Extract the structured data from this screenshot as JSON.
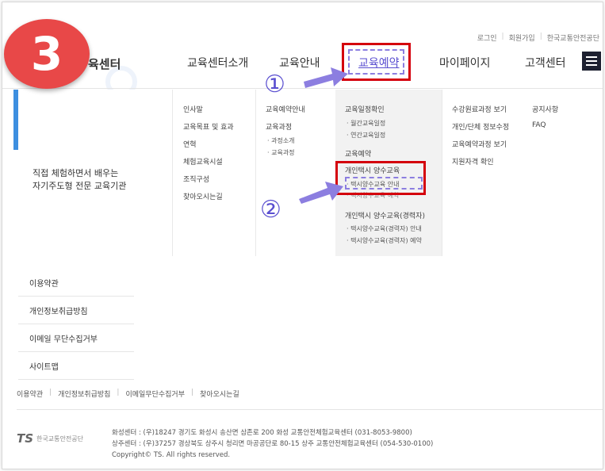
{
  "util_links": [
    "로그인",
    "회원가입",
    "한국교통안전공단"
  ],
  "step_badge": "3",
  "logo_text": "육센터",
  "gnb": {
    "items": [
      "교육센터소개",
      "교육안내",
      "교육예약",
      "마이페이지",
      "고객센터"
    ],
    "active": "교육예약"
  },
  "annotations": {
    "marker1": "①",
    "marker2": "②"
  },
  "slogan": [
    "직접 체험하면서 배우는",
    "자기주도형 전문 교육기관"
  ],
  "mega": {
    "col_intro": [
      "인사말",
      "교육목표 및 효과",
      "연혁",
      "체험교육시설",
      "조직구성",
      "찾아오시는길"
    ],
    "col_guide": {
      "title": "교육예약안내",
      "course_title": "교육과정",
      "subs": [
        "과정소개",
        "교육과정"
      ]
    },
    "col_reserve": {
      "schedule_title": "교육일정확인",
      "schedule_subs": [
        "월간교육일정",
        "연간교육일정"
      ],
      "reserve": "교육예약",
      "taxi_title": "개인택시 양수교육",
      "taxi_subs": [
        "택시양수교육 안내",
        "택시양수교육 예약"
      ],
      "taxi_career_title": "개인택시 양수교육(경력자)",
      "taxi_career_subs": [
        "택시양수교육(경력자) 안내",
        "택시양수교육(경력자) 예약"
      ]
    },
    "col_mypage": [
      "수강원료과정 보기",
      "개인/단체 정보수정",
      "교육예약과정 보기",
      "지원자격 확인"
    ],
    "col_cs": [
      "공지사항",
      "FAQ"
    ]
  },
  "side_list": [
    "이용약관",
    "개인정보취급방침",
    "이메일 무단수집거부",
    "사이트맵"
  ],
  "footer_links": [
    "이용약관",
    "개인정보취급방침",
    "이메일무단수집거부",
    "찾아오시는길"
  ],
  "footer": {
    "logo_mark": "TS",
    "logo_name": "한국교통안전공단",
    "addr1": "화성센터 : (우)18247 경기도 화성시 송산면 삼존로 200 화성 교통안전체험교육센터 (031-8053-9800)",
    "addr2": "상주센터 : (우)37257 경상북도 상주시 청리면 마공공단로 80-15 상주 교통안전체험교육센터 (054-530-0100)",
    "copyright": "Copyright© TS. All rights reserved."
  },
  "colors": {
    "accent_red": "#d4000c",
    "highlight_purple": "#8c7ee0",
    "badge_red": "#e84848",
    "side_blue": "#3d8fe0"
  }
}
